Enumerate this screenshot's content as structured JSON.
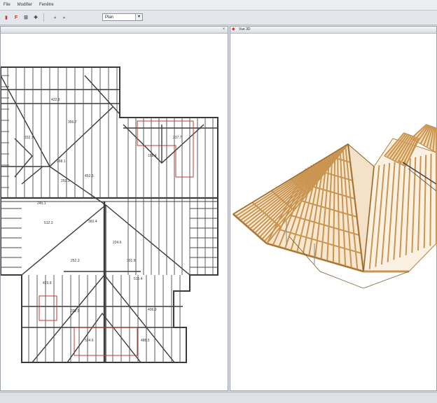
{
  "menu": {
    "items": [
      "File",
      "Modifier",
      "Fenêtre"
    ]
  },
  "toolbar": {
    "view_select_value": "Plan"
  },
  "left_pane": {
    "title": ""
  },
  "right_pane": {
    "title": "Vue 3D",
    "close_label": "×"
  },
  "plan": {
    "dimension_labels": [
      "268.1",
      "292.1",
      "245.1",
      "512.3",
      "360.4",
      "224.6",
      "252.3",
      "301.9",
      "423.9",
      "515.4",
      "322.5",
      "406.9",
      "524.6",
      "488.5",
      "356.7",
      "422.8",
      "198.4",
      "237.7",
      "332.7",
      "452.3"
    ]
  },
  "colors": {
    "timber": "#e6b46e",
    "timber_dark": "#b8803c",
    "plan_line": "#3a3a3a",
    "plan_red": "#c0392b"
  }
}
